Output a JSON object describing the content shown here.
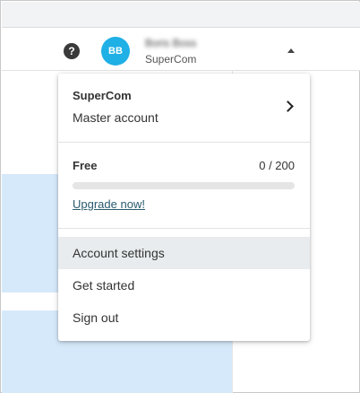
{
  "header": {
    "help_icon": "?",
    "avatar_initials": "BB",
    "user_name": "Boris Boss",
    "user_org": "SuperCom"
  },
  "dropdown": {
    "account": {
      "name": "SuperCom",
      "type": "Master account"
    },
    "plan": {
      "name": "Free",
      "usage": "0 / 200",
      "used": 0,
      "limit": 200,
      "upgrade_label": "Upgrade now!"
    },
    "menu": [
      {
        "label": "Account settings"
      },
      {
        "label": "Get started"
      },
      {
        "label": "Sign out"
      }
    ]
  },
  "colors": {
    "avatar": "#1fb0e5",
    "panel_blue": "#d6e9fa",
    "hover_row": "#e8ecee",
    "link": "#2a5a6e"
  }
}
